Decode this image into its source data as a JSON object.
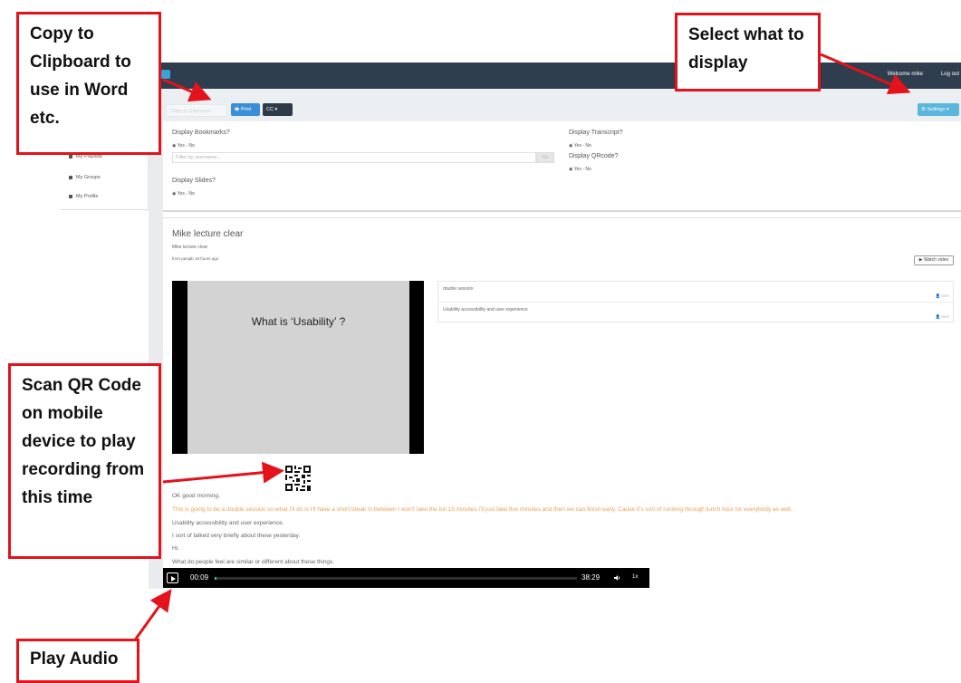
{
  "annotations": {
    "copy_clipboard": "Copy to Clipboard to use in Word etc.",
    "select_display": "Select what to display",
    "scan_qr": "Scan QR Code on mobile device to play recording from this time",
    "play_audio": "Play Audio",
    "color": "#e3121b"
  },
  "topbar": {
    "welcome": "Welcome mike",
    "logout": "Log out"
  },
  "sidebar": {
    "items": [
      {
        "label": "My Playlists",
        "icon": "list-icon"
      },
      {
        "label": "My Groups",
        "icon": "groups-icon"
      },
      {
        "label": "My Profile",
        "icon": "user-icon"
      }
    ]
  },
  "toolbar": {
    "copy_label": "Copy to Clipboard",
    "print_label": "Print",
    "cc_label": "CC",
    "settings_label": "Settings"
  },
  "settings": {
    "bookmarks_label": "Display Bookmarks?",
    "bookmarks_options": "Yes ◦ No",
    "filter_placeholder": "Filter by username...",
    "filter_button": "Go",
    "slides_label": "Display Slides?",
    "slides_options": "Yes ◦ No",
    "transcript_label": "Display Transcript?",
    "transcript_options": "Yes ◦ No",
    "qrcode_label": "Display QRcode?",
    "qrcode_options": "Yes ◦ No"
  },
  "recording": {
    "title": "Mike lecture clear",
    "subtitle": "Mike lecture clear",
    "meta": "from panjab 19 hours ago",
    "watch_label": "Watch video",
    "slide_text": "What is ‘Usability’ ?",
    "bookmarks": [
      {
        "text": "double session",
        "user": "mike"
      },
      {
        "text": "Usability accessibility and user experience",
        "user": "mike"
      }
    ]
  },
  "transcript": [
    {
      "text": "OK good morning.",
      "highlight": false
    },
    {
      "text": "This is going to be a double session so what I'll do is I'll have a short break in between I won't take the full 15 minutes I'll just take five minutes and then we can finish early. Cause it's sort of running through lunch hour for everybody as well.",
      "highlight": true
    },
    {
      "text": "Usability accessibility and user experience.",
      "highlight": false
    },
    {
      "text": "I sort of talked very briefly about these yesterday.",
      "highlight": false
    },
    {
      "text": "Hi.",
      "highlight": false
    },
    {
      "text": "What do people feel are similar or different about these things.",
      "highlight": false
    }
  ],
  "player": {
    "current_time": "00:09",
    "total_time": "38:29",
    "speed": "1x",
    "progress": 0.004,
    "accent": "#2ec7a0"
  }
}
